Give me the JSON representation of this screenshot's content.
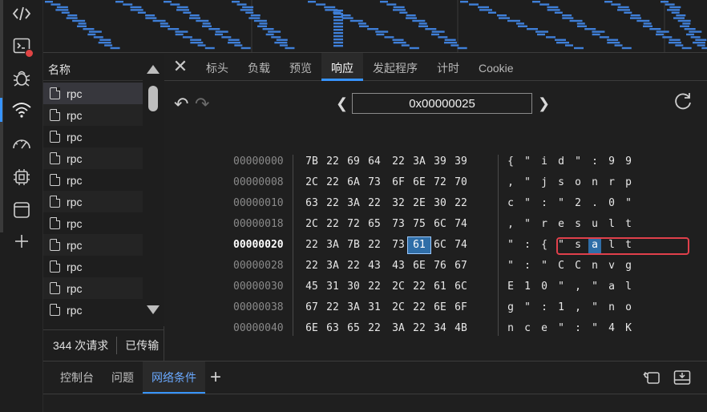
{
  "activity_bar": {
    "icons": [
      "code-icon",
      "console-icon",
      "bug-icon",
      "wifi-network-icon",
      "performance-gauge-icon",
      "cpu-chip-icon",
      "application-window-icon",
      "add-tool-icon"
    ]
  },
  "request_list": {
    "header": "名称",
    "items": [
      "rpc",
      "rpc",
      "rpc",
      "rpc",
      "rpc",
      "rpc",
      "rpc",
      "rpc",
      "rpc",
      "rpc",
      "rpc"
    ],
    "footer": {
      "requests": "344 次请求",
      "transferred": "已传输"
    }
  },
  "details": {
    "tabs": [
      "标头",
      "负载",
      "预览",
      "响应",
      "发起程序",
      "计时",
      "Cookie"
    ],
    "active_tab": "响应",
    "address": "0x00000025",
    "hex_rows": [
      {
        "offset": "00000000",
        "bytes": [
          "7B",
          "22",
          "69",
          "64",
          "22",
          "3A",
          "39",
          "39"
        ],
        "chars": [
          "{",
          "\"",
          "i",
          "d",
          "\"",
          ":",
          "9",
          "9"
        ]
      },
      {
        "offset": "00000008",
        "bytes": [
          "2C",
          "22",
          "6A",
          "73",
          "6F",
          "6E",
          "72",
          "70"
        ],
        "chars": [
          ",",
          "\"",
          "j",
          "s",
          "o",
          "n",
          "r",
          "p"
        ]
      },
      {
        "offset": "00000010",
        "bytes": [
          "63",
          "22",
          "3A",
          "22",
          "32",
          "2E",
          "30",
          "22"
        ],
        "chars": [
          "c",
          "\"",
          ":",
          "\"",
          "2",
          ".",
          "0",
          "\""
        ]
      },
      {
        "offset": "00000018",
        "bytes": [
          "2C",
          "22",
          "72",
          "65",
          "73",
          "75",
          "6C",
          "74"
        ],
        "chars": [
          ",",
          "\"",
          "r",
          "e",
          "s",
          "u",
          "l",
          "t"
        ]
      },
      {
        "offset": "00000020",
        "bytes": [
          "22",
          "3A",
          "7B",
          "22",
          "73",
          "61",
          "6C",
          "74"
        ],
        "chars": [
          "\"",
          ":",
          "{",
          "\"",
          "s",
          "a",
          "l",
          "t"
        ]
      },
      {
        "offset": "00000028",
        "bytes": [
          "22",
          "3A",
          "22",
          "43",
          "43",
          "6E",
          "76",
          "67"
        ],
        "chars": [
          "\"",
          ":",
          "\"",
          "C",
          "C",
          "n",
          "v",
          "g"
        ]
      },
      {
        "offset": "00000030",
        "bytes": [
          "45",
          "31",
          "30",
          "22",
          "2C",
          "22",
          "61",
          "6C"
        ],
        "chars": [
          "E",
          "1",
          "0",
          "\"",
          ",",
          "\"",
          "a",
          "l"
        ]
      },
      {
        "offset": "00000038",
        "bytes": [
          "67",
          "22",
          "3A",
          "31",
          "2C",
          "22",
          "6E",
          "6F"
        ],
        "chars": [
          "g",
          "\"",
          ":",
          "1",
          ",",
          "\"",
          "n",
          "o"
        ]
      },
      {
        "offset": "00000040",
        "bytes": [
          "6E",
          "63",
          "65",
          "22",
          "3A",
          "22",
          "34",
          "4B"
        ],
        "chars": [
          "n",
          "c",
          "e",
          "\"",
          ":",
          "\"",
          "4",
          "K"
        ]
      }
    ],
    "selected_row": 4,
    "selected_col": 5
  },
  "drawer": {
    "tabs": [
      "控制台",
      "问题",
      "网络条件"
    ],
    "active_tab": "网络条件",
    "plus": "+"
  },
  "colors": {
    "accent": "#3794ff",
    "highlight_box": "#e0404b",
    "selection": "#2f6ea8",
    "overview_bars": "#3f7fd8"
  }
}
